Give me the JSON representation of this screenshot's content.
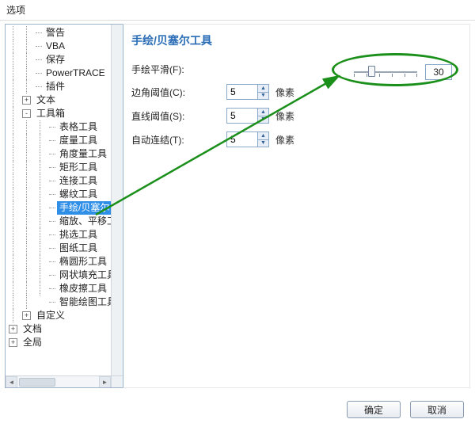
{
  "window_title": "选项",
  "tree": {
    "warn": "警告",
    "vba": "VBA",
    "save": "保存",
    "powertrace": "PowerTRACE",
    "plugin": "插件",
    "text": "文本",
    "toolbox": "工具箱",
    "tb_table": "表格工具",
    "tb_dim": "度量工具",
    "tb_angle": "角度量工具",
    "tb_rect": "矩形工具",
    "tb_connect": "连接工具",
    "tb_spiral": "螺纹工具",
    "tb_freehand": "手绘/贝塞尔",
    "tb_zoom": "缩放、平移工",
    "tb_pick": "挑选工具",
    "tb_graph": "图纸工具",
    "tb_ellipse": "椭圆形工具",
    "tb_mesh": "网状填充工具",
    "tb_eraser": "橡皮擦工具",
    "tb_smart": "智能绘图工具",
    "custom": "自定义",
    "doc": "文档",
    "global": "全局"
  },
  "panel": {
    "heading": "手绘/贝塞尔工具",
    "smooth_label": "手绘平滑(F):",
    "corner_label": "边角阈值(C):",
    "line_label": "直线阈值(S):",
    "auto_label": "自动连结(T):",
    "unit": "像素",
    "corner_value": "5",
    "line_value": "5",
    "auto_value": "5",
    "smooth_value": "30"
  },
  "buttons": {
    "ok": "确定",
    "cancel": "取消"
  }
}
